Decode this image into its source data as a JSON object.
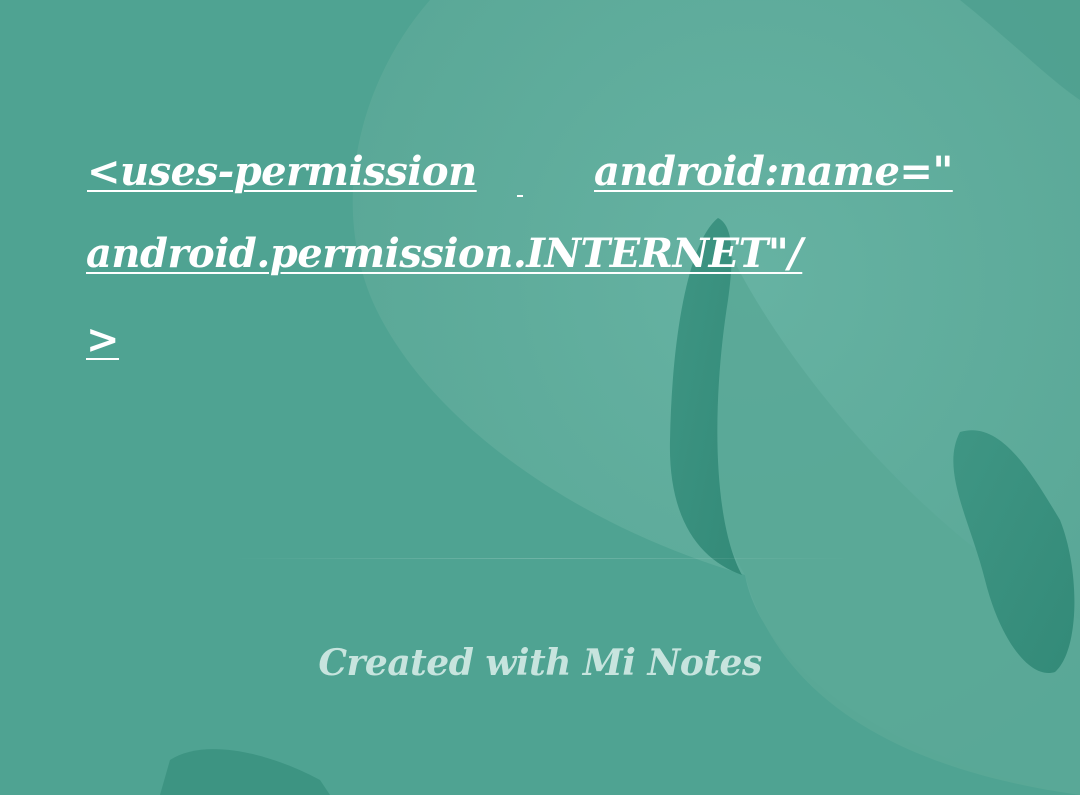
{
  "note": {
    "line1_part1": "<uses-permission",
    "line1_part2": "android:name=\"",
    "line2": "android.permission.INTERNET\"/",
    "line3": ">"
  },
  "footer": {
    "credit": "Created with Mi Notes"
  },
  "colors": {
    "background": "#4fa392",
    "leaf_light": "#5fae9e",
    "leaf_dark": "#3a9180",
    "text": "#ffffff"
  }
}
